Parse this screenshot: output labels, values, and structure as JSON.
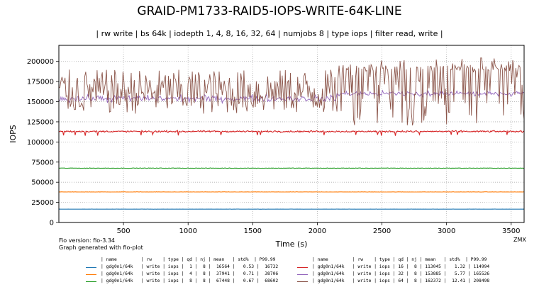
{
  "title": "GRAID-PM1733-RAID5-IOPS-WRITE-64K-LINE",
  "subtitle": "| rw write | bs 64k | iodepth 1, 4, 8, 16, 32, 64 | numjobs 8 | type iops | filter read, write |",
  "footer": {
    "fio_version": "Fio version: fio-3.34",
    "generated": "Graph generated with fio-plot",
    "brand": "ZMX"
  },
  "legend_header": "| name         | rw    | type | qd | nj | mean   | std%  | P99.99",
  "chart_data": {
    "type": "line",
    "title": "GRAID-PM1733-RAID5-IOPS-WRITE-64K-LINE",
    "xlabel": "Time (s)",
    "ylabel": "IOPS",
    "xlim": [
      0,
      3600
    ],
    "ylim": [
      0,
      220000
    ],
    "xticks": [
      500,
      1000,
      1500,
      2000,
      2500,
      3000,
      3500
    ],
    "yticks": [
      0,
      25000,
      50000,
      75000,
      100000,
      125000,
      150000,
      175000,
      200000
    ],
    "grid": true,
    "legend_position": "bottom",
    "series": [
      {
        "name": "gdg0n1/64k",
        "rw": "write",
        "type": "iops",
        "qd": 1,
        "nj": 8,
        "mean": 16564,
        "std_pct": 0.53,
        "p9999": 16732,
        "color": "#1f77b4"
      },
      {
        "name": "gdg0n1/64k",
        "rw": "write",
        "type": "iops",
        "qd": 4,
        "nj": 8,
        "mean": 37941,
        "std_pct": 0.71,
        "p9999": 38706,
        "color": "#ff7f0e"
      },
      {
        "name": "gdg0n1/64k",
        "rw": "write",
        "type": "iops",
        "qd": 8,
        "nj": 8,
        "mean": 67448,
        "std_pct": 0.67,
        "p9999": 68602,
        "color": "#2ca02c"
      },
      {
        "name": "gdg0n1/64k",
        "rw": "write",
        "type": "iops",
        "qd": 16,
        "nj": 8,
        "mean": 113045,
        "std_pct": 1.32,
        "p9999": 114994,
        "color": "#d62728"
      },
      {
        "name": "gdg0n1/64k",
        "rw": "write",
        "type": "iops",
        "qd": 32,
        "nj": 8,
        "mean": 153885,
        "std_pct": 5.77,
        "p9999": 165526,
        "color": "#9467bd"
      },
      {
        "name": "gdg0n1/64k",
        "rw": "write",
        "type": "iops",
        "qd": 64,
        "nj": 8,
        "mean": 162372,
        "std_pct": 12.41,
        "p9999": 208498,
        "color": "#8c564b"
      }
    ]
  }
}
